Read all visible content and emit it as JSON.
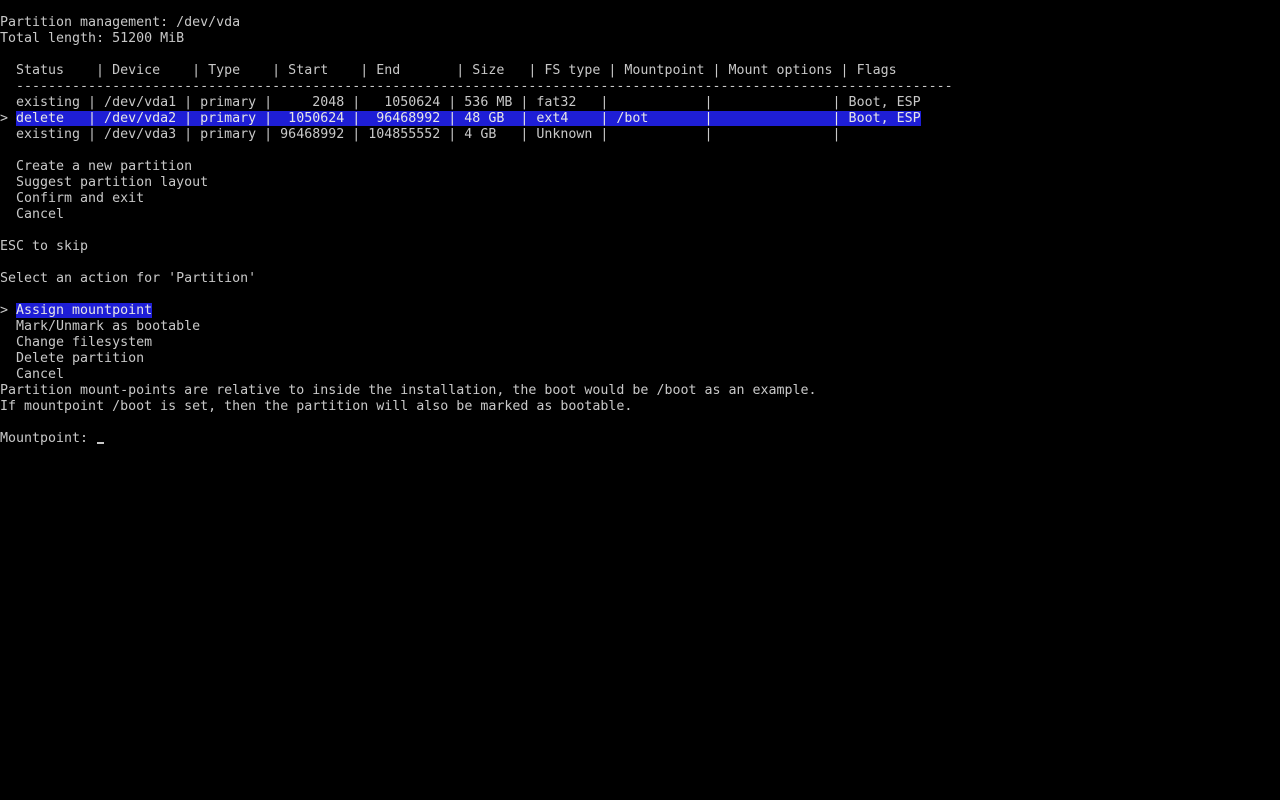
{
  "header": {
    "title": "Partition management: /dev/vda",
    "total_length": "Total length: 51200 MiB"
  },
  "table": {
    "header": "Status    | Device    | Type    | Start    | End       | Size   | FS type | Mountpoint | Mount options | Flags",
    "separator": "---------------------------------------------------------------------------------------------------------------------",
    "selected_pointer": ">",
    "rows": [
      "existing | /dev/vda1 | primary |     2048 |   1050624 | 536 MB | fat32   |            |               | Boot, ESP",
      "delete   | /dev/vda2 | primary |  1050624 |  96468992 | 48 GB  | ext4    | /bot       |               | Boot, ESP",
      "existing | /dev/vda3 | primary | 96468992 | 104855552 | 4 GB   | Unknown |            |               |"
    ]
  },
  "partition_menu": {
    "items": [
      "Create a new partition",
      "Suggest partition layout",
      "Confirm and exit",
      "Cancel"
    ]
  },
  "esc_hint": "ESC to skip",
  "action_prompt": "Select an action for 'Partition'",
  "action_menu": {
    "pointer": ">",
    "items": [
      "Assign mountpoint",
      "Mark/Unmark as bootable",
      "Change filesystem",
      "Delete partition",
      "Cancel"
    ]
  },
  "help": {
    "line1": "Partition mount-points are relative to inside the installation, the boot would be /boot as an example.",
    "line2": "If mountpoint /boot is set, then the partition will also be marked as bootable."
  },
  "mountpoint_input": {
    "label": "Mountpoint:",
    "value": ""
  },
  "colors": {
    "background": "#000000",
    "text": "#c8c8c8",
    "highlight_bg": "#1e1ed6",
    "highlight_text": "#e6e6e6"
  }
}
